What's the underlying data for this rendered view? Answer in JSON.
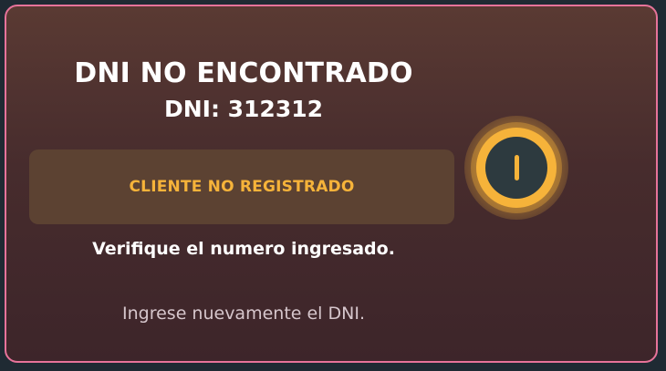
{
  "dialog": {
    "title": "DNI NO ENCONTRADO",
    "dni_line": "DNI: 312312",
    "status": "CLIENTE NO REGISTRADO",
    "verify_message": "Verifique el numero ingresado.",
    "retry_message": "Ingrese nuevamente el DNI.",
    "icon": "warning-info-icon"
  },
  "colors": {
    "accent": "#f6b33a",
    "border": "#e7739a",
    "background_top": "#5a3a33",
    "background_bottom": "#3d252a",
    "status_box": "#5c4232"
  }
}
